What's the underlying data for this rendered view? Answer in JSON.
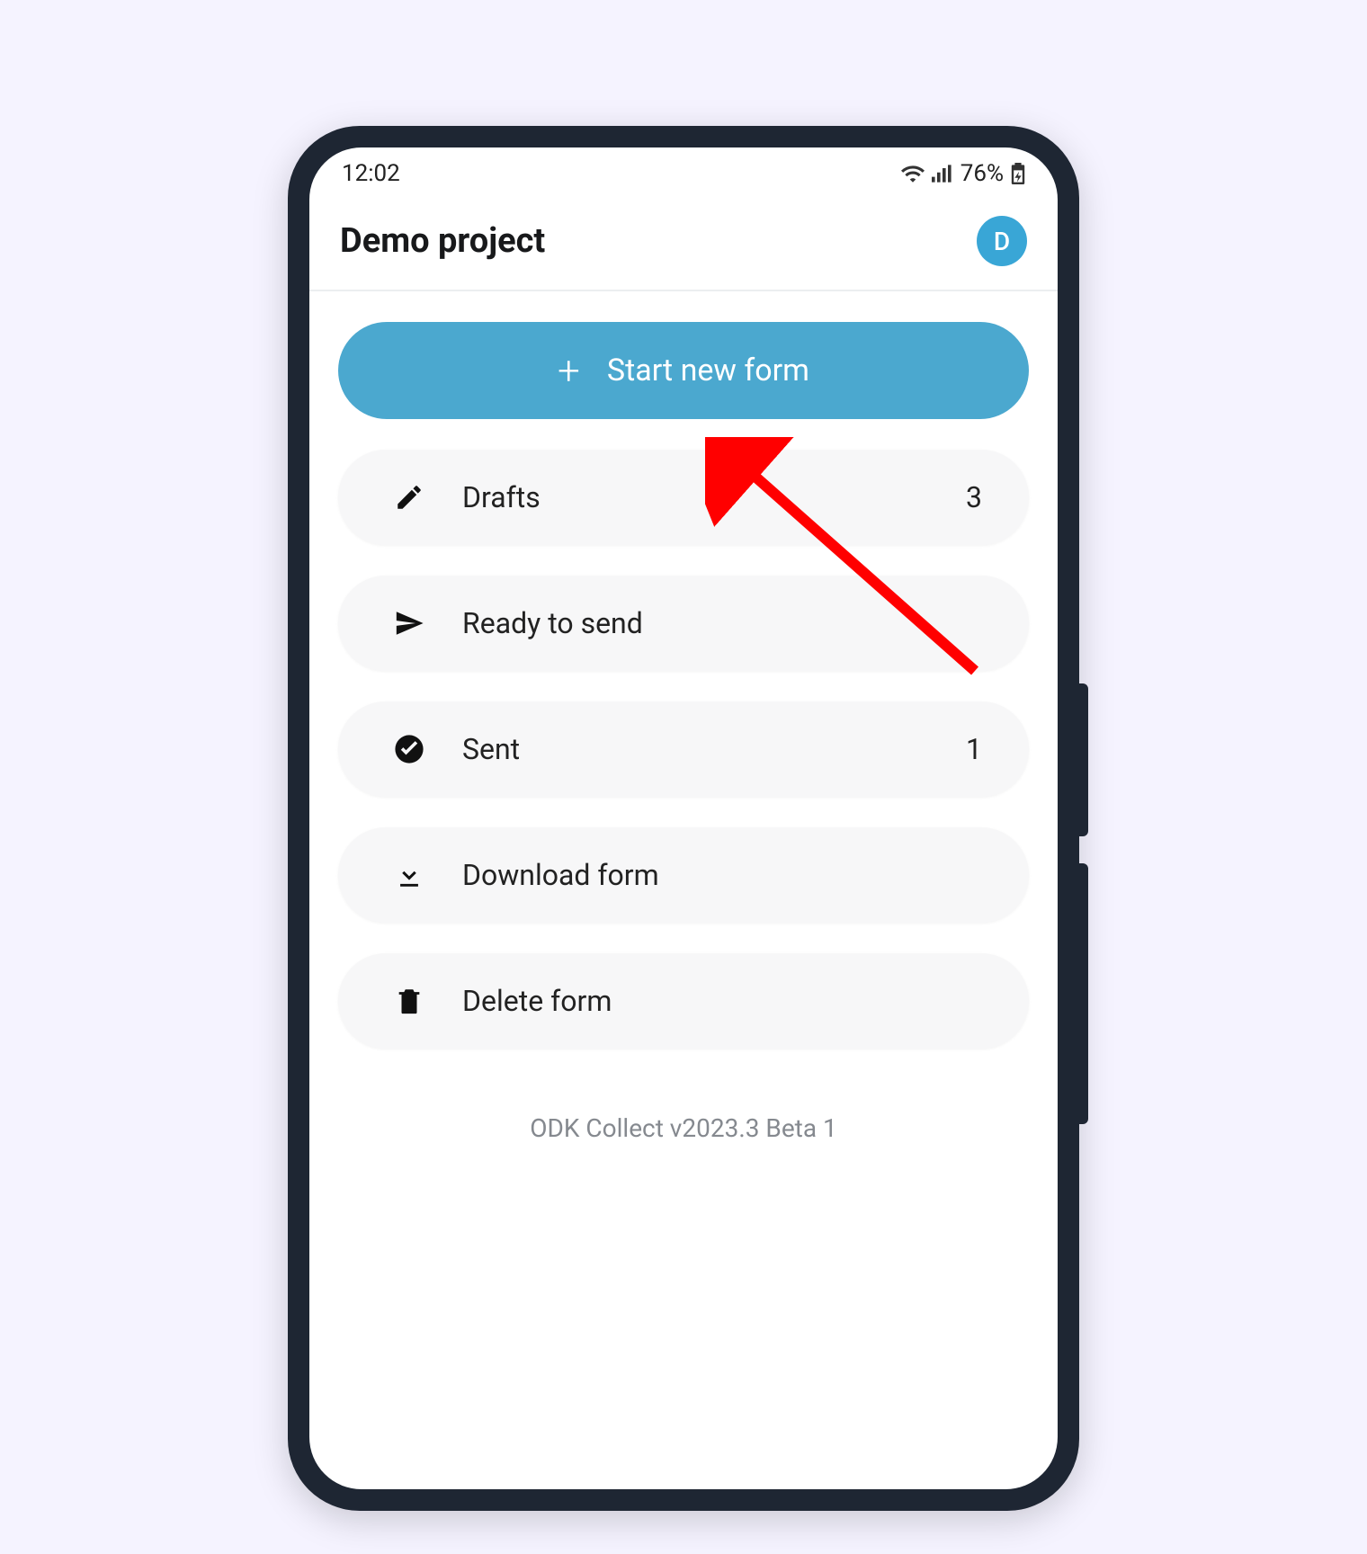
{
  "statusbar": {
    "time": "12:02",
    "battery_text": "76%"
  },
  "header": {
    "title": "Demo project",
    "avatar_initial": "D"
  },
  "primary_button": {
    "label": "Start new form"
  },
  "rows": {
    "drafts": {
      "label": "Drafts",
      "count": "3"
    },
    "ready": {
      "label": "Ready to send",
      "count": ""
    },
    "sent": {
      "label": "Sent",
      "count": "1"
    },
    "download": {
      "label": "Download form",
      "count": ""
    },
    "delete": {
      "label": "Delete form",
      "count": ""
    }
  },
  "footer": {
    "version": "ODK Collect v2023.3 Beta 1"
  },
  "annotation": {
    "type": "arrow",
    "color": "#ff0000",
    "points_to": "drafts-row"
  }
}
